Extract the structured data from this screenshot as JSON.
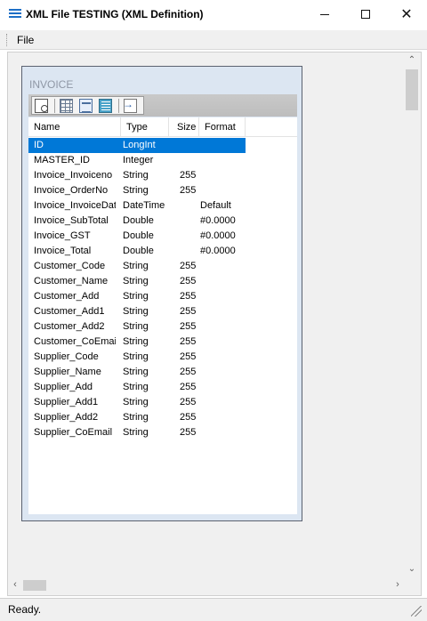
{
  "window": {
    "title": "XML File TESTING (XML Definition)",
    "app_icon": "hamburger-lines-icon",
    "controls": {
      "minimize": "minimize-icon",
      "maximize": "maximize-icon",
      "close": "✕"
    }
  },
  "menu": {
    "file": "File"
  },
  "table": {
    "title": "INVOICE",
    "toolbar_icons": [
      "preview-icon",
      "grid-icon",
      "properties-icon",
      "calculator-icon",
      "export-icon"
    ],
    "columns": {
      "name": "Name",
      "type": "Type",
      "size": "Size",
      "format": "Format"
    },
    "rows": [
      {
        "name": "ID",
        "type": "LongInt",
        "size": "",
        "format": "",
        "selected": true
      },
      {
        "name": "MASTER_ID",
        "type": "Integer",
        "size": "",
        "format": ""
      },
      {
        "name": "Invoice_Invoiceno",
        "type": "String",
        "size": "255",
        "format": ""
      },
      {
        "name": "Invoice_OrderNo",
        "type": "String",
        "size": "255",
        "format": ""
      },
      {
        "name": "Invoice_InvoiceDate",
        "type": "DateTime",
        "size": "",
        "format": "Default"
      },
      {
        "name": "Invoice_SubTotal",
        "type": "Double",
        "size": "",
        "format": "#0.0000"
      },
      {
        "name": "Invoice_GST",
        "type": "Double",
        "size": "",
        "format": "#0.0000"
      },
      {
        "name": "Invoice_Total",
        "type": "Double",
        "size": "",
        "format": "#0.0000"
      },
      {
        "name": "Customer_Code",
        "type": "String",
        "size": "255",
        "format": ""
      },
      {
        "name": "Customer_Name",
        "type": "String",
        "size": "255",
        "format": ""
      },
      {
        "name": "Customer_Add",
        "type": "String",
        "size": "255",
        "format": ""
      },
      {
        "name": "Customer_Add1",
        "type": "String",
        "size": "255",
        "format": ""
      },
      {
        "name": "Customer_Add2",
        "type": "String",
        "size": "255",
        "format": ""
      },
      {
        "name": "Customer_CoEmail",
        "type": "String",
        "size": "255",
        "format": ""
      },
      {
        "name": "Supplier_Code",
        "type": "String",
        "size": "255",
        "format": ""
      },
      {
        "name": "Supplier_Name",
        "type": "String",
        "size": "255",
        "format": ""
      },
      {
        "name": "Supplier_Add",
        "type": "String",
        "size": "255",
        "format": ""
      },
      {
        "name": "Supplier_Add1",
        "type": "String",
        "size": "255",
        "format": ""
      },
      {
        "name": "Supplier_Add2",
        "type": "String",
        "size": "255",
        "format": ""
      },
      {
        "name": "Supplier_CoEmail",
        "type": "String",
        "size": "255",
        "format": ""
      }
    ]
  },
  "status": {
    "text": "Ready."
  },
  "colors": {
    "selection": "#0078d7",
    "table_window_bg": "#dce6f2",
    "app_icon": "#1e6fc6"
  }
}
